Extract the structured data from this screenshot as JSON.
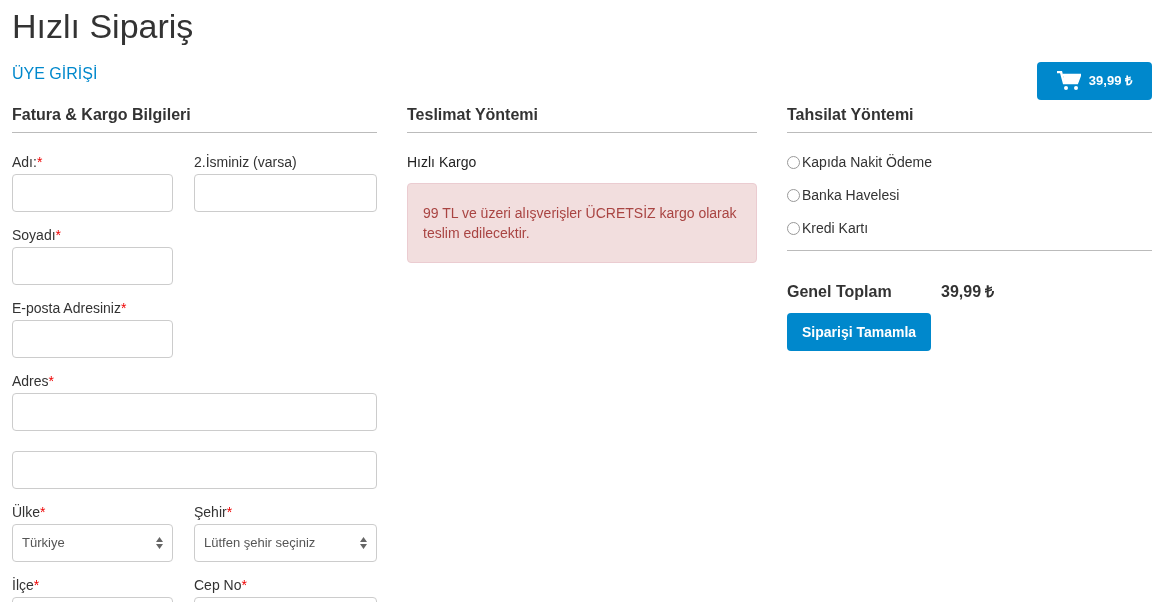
{
  "title": "Hızlı Sipariş",
  "login_link": "ÜYE GİRİŞİ",
  "cart_button": {
    "total": "39,99 ₺"
  },
  "billing": {
    "heading": "Fatura & Kargo Bilgileri",
    "rows": [
      [
        {
          "label": "Adı:",
          "required_mark": "*",
          "kind": "input"
        },
        {
          "label": "2.İsminiz (varsa)",
          "kind": "input"
        }
      ],
      [
        {
          "label": "Soyadı",
          "required_mark": "*",
          "kind": "input"
        }
      ],
      [
        {
          "label": "E-posta Adresiniz",
          "required_mark": "*",
          "kind": "input"
        }
      ],
      [
        {
          "label": "Adres",
          "required_mark": "*",
          "kind": "address"
        }
      ],
      [
        {
          "label": "Ülke",
          "required_mark": "*",
          "kind": "select",
          "value": "Türkiye"
        },
        {
          "label": "Şehir",
          "required_mark": "*",
          "kind": "select",
          "value": "Lütfen şehir seçiniz"
        }
      ],
      [
        {
          "label": "İlçe",
          "required_mark": "*",
          "kind": "input"
        },
        {
          "label": "Cep No",
          "required_mark": "*",
          "kind": "input"
        }
      ]
    ]
  },
  "delivery": {
    "heading": "Teslimat Yöntemi",
    "method": "Hızlı Kargo",
    "notice": "99 TL ve üzeri alışverişler ÜCRETSİZ kargo olarak teslim edilecektir."
  },
  "payment": {
    "heading": "Tahsilat Yöntemi",
    "options": [
      {
        "label": "Kapıda Nakit Ödeme",
        "selected": false
      },
      {
        "label": "Banka Havelesi",
        "selected": false
      },
      {
        "label": "Kredi Kartı",
        "selected": false
      }
    ],
    "total_label": "Genel Toplam",
    "total_value": "39,99 ₺",
    "submit": "Siparişi Tamamla"
  }
}
